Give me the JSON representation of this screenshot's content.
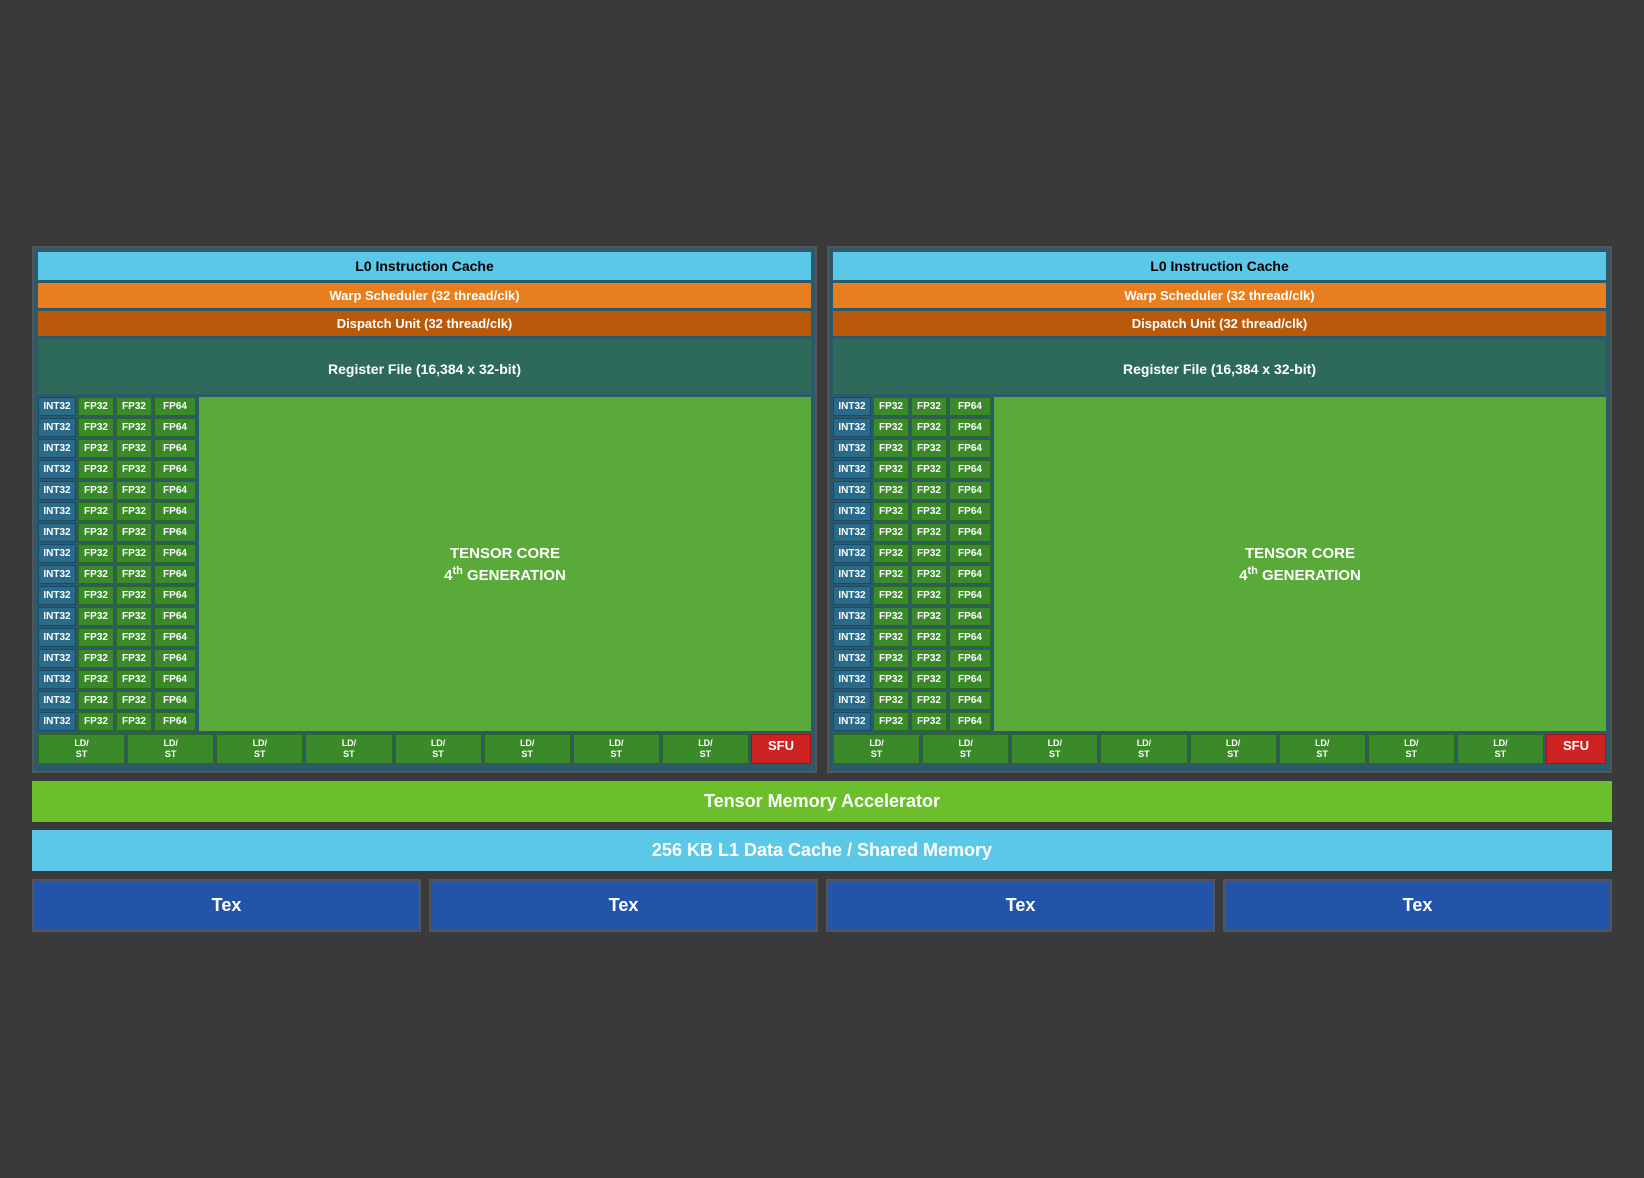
{
  "sm": {
    "l0_cache": "L0 Instruction Cache",
    "warp_scheduler": "Warp Scheduler (32 thread/clk)",
    "dispatch_unit": "Dispatch Unit (32 thread/clk)",
    "register_file": "Register File (16,384 x 32-bit)",
    "tensor_core_line1": "TENSOR CORE",
    "tensor_core_line2": "4",
    "tensor_core_sup": "th",
    "tensor_core_line3": "GENERATION",
    "sfu": "SFU",
    "rows": 16,
    "ldst_cols": 8
  },
  "bottom": {
    "tma": "Tensor Memory Accelerator",
    "l1": "256 KB L1 Data Cache / Shared Memory",
    "tex_boxes": [
      "Tex",
      "Tex",
      "Tex",
      "Tex"
    ]
  }
}
